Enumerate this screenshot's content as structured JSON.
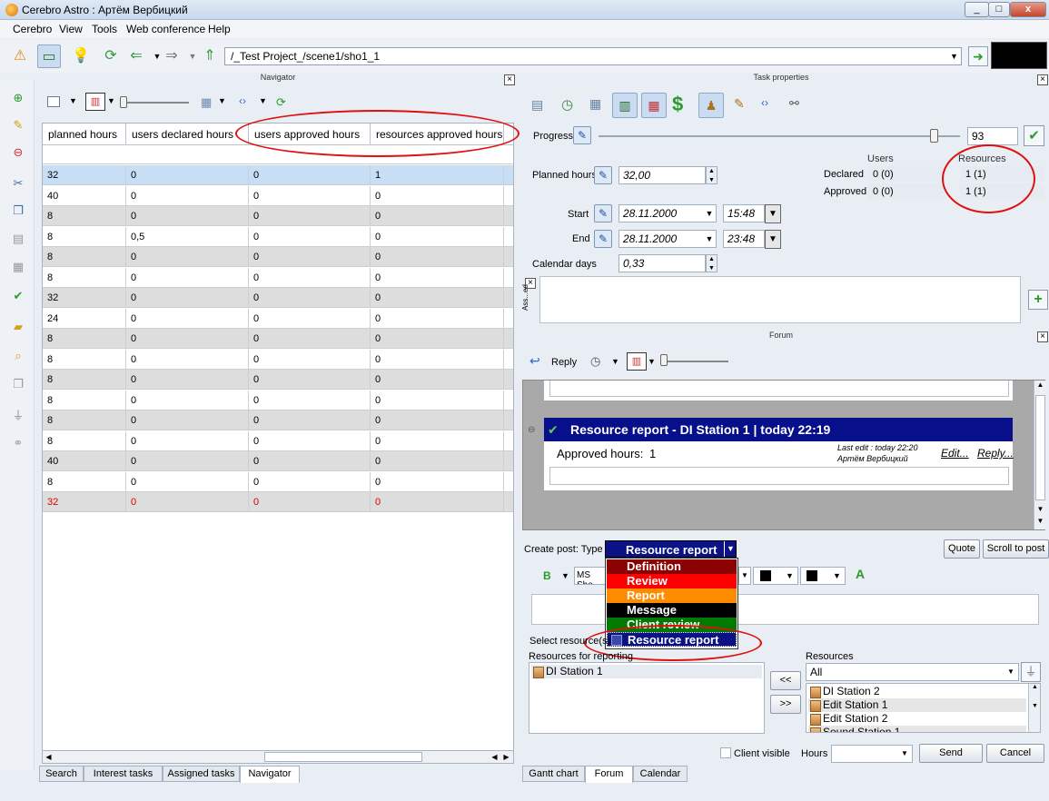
{
  "window": {
    "title": "Cerebro Astro : Артём Вербицкий",
    "controls": [
      "_",
      "□",
      "x"
    ]
  },
  "menu": [
    "Cerebro",
    "View",
    "Tools",
    "Web conference",
    "Help"
  ],
  "toolbar": {
    "path": "/_Test Project_/scene1/sho1_1"
  },
  "navigator": {
    "panel_title": "Navigator",
    "columns": [
      "planned hours",
      "users declared hours",
      "users approved hours",
      "resources approved hours"
    ],
    "rows": [
      {
        "planned": "32",
        "declared": "0",
        "approved": "0",
        "res": "1",
        "style": "sel"
      },
      {
        "planned": "40",
        "declared": "0",
        "approved": "0",
        "res": "0",
        "style": ""
      },
      {
        "planned": "8",
        "declared": "0",
        "approved": "0",
        "res": "0",
        "style": "grey"
      },
      {
        "planned": "8",
        "declared": "0,5",
        "approved": "0",
        "res": "0",
        "style": ""
      },
      {
        "planned": "8",
        "declared": "0",
        "approved": "0",
        "res": "0",
        "style": "grey"
      },
      {
        "planned": "8",
        "declared": "0",
        "approved": "0",
        "res": "0",
        "style": ""
      },
      {
        "planned": "32",
        "declared": "0",
        "approved": "0",
        "res": "0",
        "style": "grey"
      },
      {
        "planned": "24",
        "declared": "0",
        "approved": "0",
        "res": "0",
        "style": ""
      },
      {
        "planned": "8",
        "declared": "0",
        "approved": "0",
        "res": "0",
        "style": "grey"
      },
      {
        "planned": "8",
        "declared": "0",
        "approved": "0",
        "res": "0",
        "style": ""
      },
      {
        "planned": "8",
        "declared": "0",
        "approved": "0",
        "res": "0",
        "style": "grey"
      },
      {
        "planned": "8",
        "declared": "0",
        "approved": "0",
        "res": "0",
        "style": ""
      },
      {
        "planned": "8",
        "declared": "0",
        "approved": "0",
        "res": "0",
        "style": "grey"
      },
      {
        "planned": "8",
        "declared": "0",
        "approved": "0",
        "res": "0",
        "style": ""
      },
      {
        "planned": "40",
        "declared": "0",
        "approved": "0",
        "res": "0",
        "style": "grey"
      },
      {
        "planned": "8",
        "declared": "0",
        "approved": "0",
        "res": "0",
        "style": ""
      },
      {
        "planned": "32",
        "declared": "0",
        "approved": "0",
        "res": "0",
        "style": "grey red"
      }
    ],
    "tabs": [
      "Search",
      "Interest tasks",
      "Assigned tasks",
      "Navigator"
    ]
  },
  "task_properties": {
    "panel_title": "Task properties",
    "progress_label": "Progress",
    "progress_value": "93",
    "progress_fraction": 0.93,
    "planned_hours_label": "Planned hours",
    "planned_hours": "32,00",
    "users_header": "Users",
    "resources_header": "Resources",
    "declared_label": "Declared",
    "approved_label": "Approved",
    "users_declared": "0 (0)",
    "users_approved": "0 (0)",
    "res_declared": "1 (1)",
    "res_approved": "1 (1)",
    "start_label": "Start",
    "start_date": "28.11.2000",
    "start_time": "15:48",
    "end_label": "End",
    "end_date": "28.11.2000",
    "end_time": "23:48",
    "calendar_days_label": "Calendar days",
    "calendar_days": "0,33",
    "assigned_label": "Ass...ed"
  },
  "forum": {
    "panel_title": "Forum",
    "reply_label": "Reply",
    "post_title": "Resource report - DI Station 1 | today 22:19",
    "post_body_label": "Approved hours:",
    "post_body_value": "1",
    "last_edit": "Last edit : today 22:20",
    "author": "Артём Вербицкий",
    "edit_link": "Edit...",
    "reply_link": "Reply..."
  },
  "create_post": {
    "type_label": "Create post: Type -",
    "selected_type": "Resource report",
    "options": [
      {
        "label": "Definition",
        "color": "#8b0000"
      },
      {
        "label": "Review",
        "color": "#ff0000"
      },
      {
        "label": "Report",
        "color": "#ff8c00"
      },
      {
        "label": "Message",
        "color": "#000000"
      },
      {
        "label": "Client review",
        "color": "#007a00"
      },
      {
        "label": "Resource report",
        "color": "#0a1286"
      }
    ],
    "quote_btn": "Quote",
    "scroll_btn": "Scroll to post",
    "font_value": "MS She",
    "select_resources_label": "Select resource(s)",
    "resources_for_reporting_label": "Resources for reporting",
    "reporting_items": [
      "DI Station 1"
    ],
    "resources_label": "Resources",
    "resources_filter": "All",
    "resource_items": [
      "DI Station 2",
      "Edit Station 1",
      "Edit Station 2",
      "Sound Station 1"
    ],
    "move_left": "<<",
    "move_right": ">>",
    "client_visible": "Client visible",
    "hours_label": "Hours",
    "send_btn": "Send",
    "cancel_btn": "Cancel"
  },
  "bottom_tabs": [
    "Gantt chart",
    "Forum",
    "Calendar"
  ]
}
